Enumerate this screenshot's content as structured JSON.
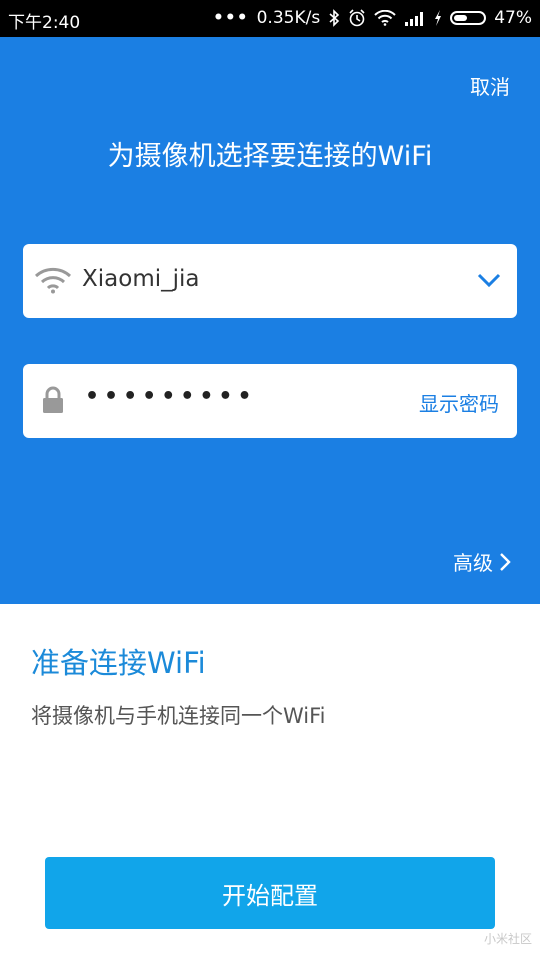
{
  "status_bar": {
    "time": "下午2:40",
    "speed": "0.35K/s",
    "battery": "47%",
    "battery_level": 47
  },
  "header": {
    "cancel": "取消",
    "title": "为摄像机选择要连接的WiFi"
  },
  "wifi_field": {
    "ssid": "Xiaomi_jia",
    "icon": "wifi-icon",
    "dropdown_icon": "chevron-down-icon"
  },
  "password_field": {
    "masked_value": "•••••••••",
    "show_password": "显示密码",
    "icon": "lock-icon"
  },
  "advanced": {
    "label": "高级",
    "icon": "chevron-right-icon"
  },
  "prepare": {
    "title": "准备连接WiFi",
    "description": "将摄像机与手机连接同一个WiFi"
  },
  "start_button": {
    "label": "开始配置"
  },
  "watermark": "小米社区",
  "colors": {
    "primary": "#1b7fe3",
    "button": "#11a5ea",
    "prepare_title": "#1b8ad9"
  }
}
